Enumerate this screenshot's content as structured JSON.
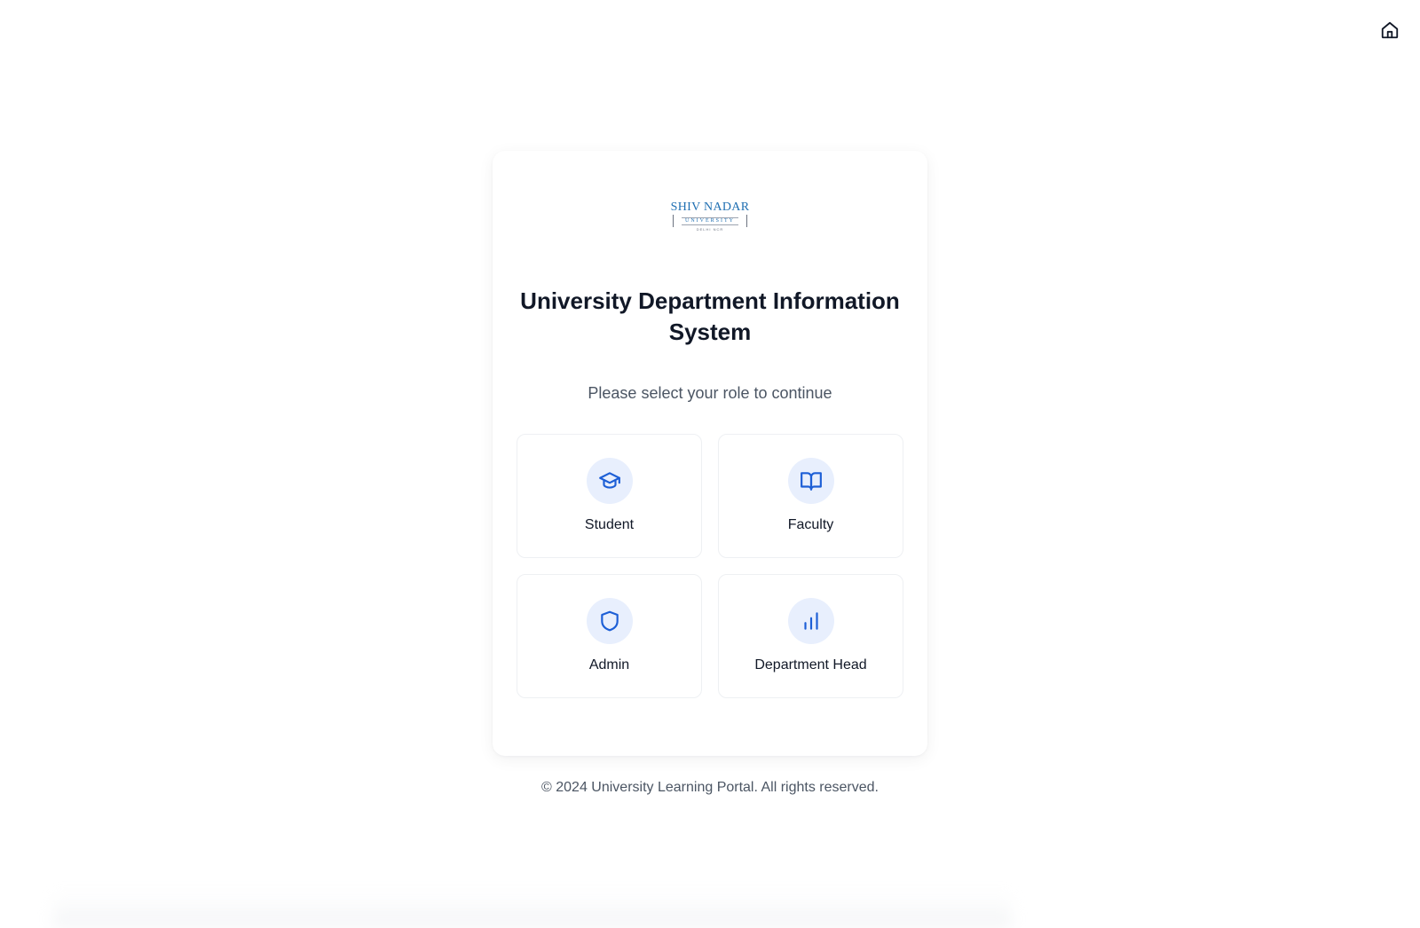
{
  "header": {
    "home_icon": "home-icon"
  },
  "logo": {
    "name": "SHIV NADAR",
    "tagline": "INSTITUTION OF EMINENCE DEEMED TO BE",
    "university": "UNIVERSITY",
    "location": "DELHI NCR"
  },
  "login_card": {
    "title": "University Department Information System",
    "subtitle": "Please select your role to continue",
    "roles": [
      {
        "label": "Student",
        "icon": "graduation-cap-icon"
      },
      {
        "label": "Faculty",
        "icon": "book-open-icon"
      },
      {
        "label": "Admin",
        "icon": "shield-icon"
      },
      {
        "label": "Department Head",
        "icon": "bar-chart-icon"
      }
    ]
  },
  "footer": {
    "text": "© 2024 University Learning Portal. All rights reserved."
  },
  "colors": {
    "accent": "#1d5fd6",
    "icon_bg": "#e8effd",
    "logo_blue": "#1f6fb2",
    "title": "#111827",
    "muted_text": "#4b5563"
  }
}
